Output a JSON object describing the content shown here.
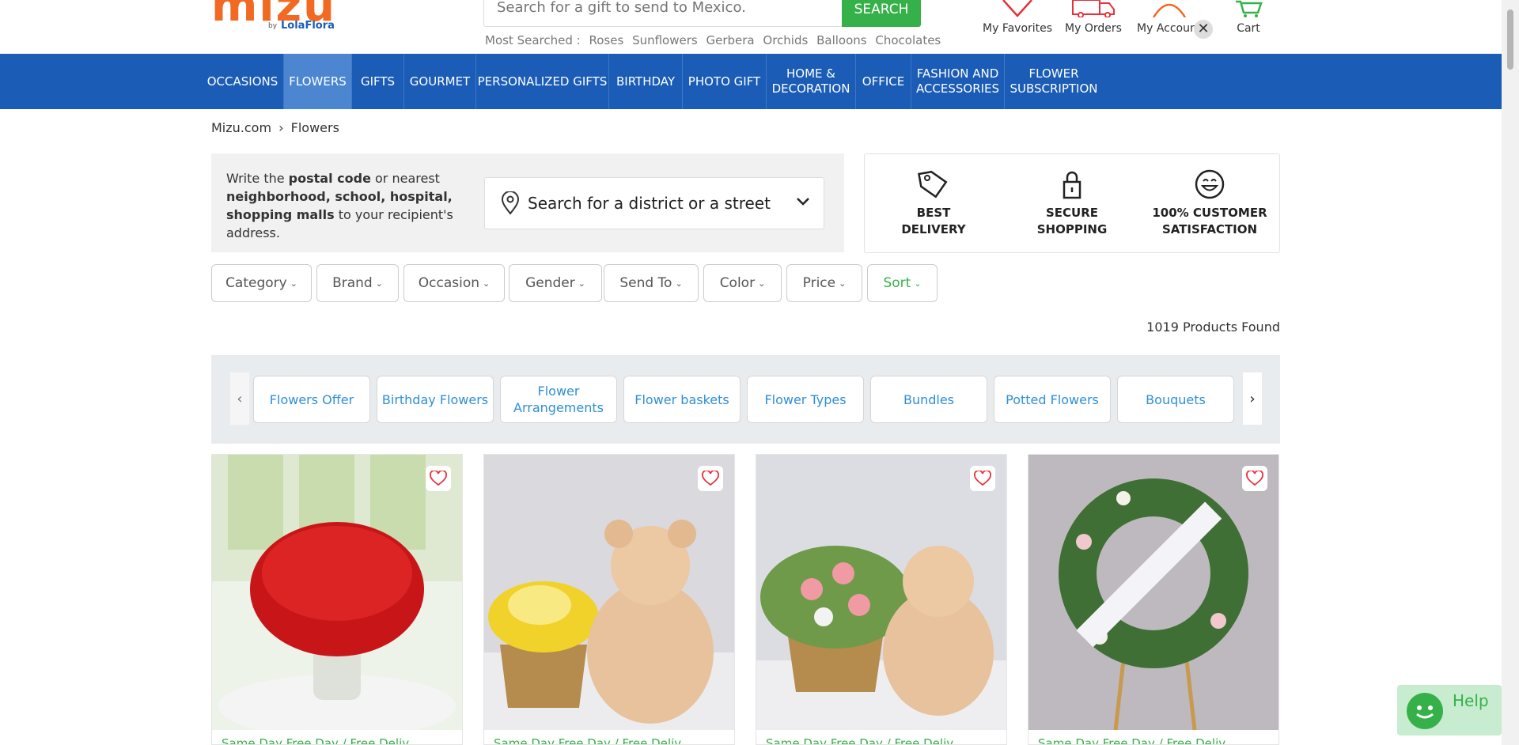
{
  "header": {
    "logo_text": "mizu",
    "logo_by": "by",
    "logo_brand": "LolaFlora",
    "search_placeholder": "Search for a gift to send to Mexico.",
    "search_button": "SEARCH",
    "most_searched_label": "Most Searched :",
    "most_searched": [
      "Roses",
      "Sunflowers",
      "Gerbera",
      "Orchids",
      "Balloons",
      "Chocolates"
    ],
    "favorites": "My Favorites",
    "orders": "My Orders",
    "account": "My Account",
    "cart": "Cart",
    "close": "✕"
  },
  "nav": {
    "items": [
      "OCCASIONS",
      "FLOWERS",
      "GIFTS",
      "GOURMET",
      "PERSONALIZED GIFTS",
      "BIRTHDAY",
      "PHOTO GIFT",
      "HOME &\nDECORATION",
      "OFFICE",
      "FASHION AND\nACCESSORIES",
      "FLOWER\nSUBSCRIPTION"
    ],
    "active": "FLOWERS"
  },
  "breadcrumb": {
    "home": "Mizu.com",
    "separator": "›",
    "current": "Flowers"
  },
  "address": {
    "t1": "Write the ",
    "b1": "postal code",
    "t2": " or nearest ",
    "b2": "neighborhood, school, hospital, shopping malls",
    "t3": " to your recipient's address.",
    "district_placeholder": "Search for a district or a street"
  },
  "features": [
    {
      "icon": "tag-icon",
      "label": "BEST\nDELIVERY"
    },
    {
      "icon": "lock-icon",
      "label": "SECURE\nSHOPPING"
    },
    {
      "icon": "smile-icon",
      "label": "100% CUSTOMER\nSATISFACTION"
    }
  ],
  "filters": [
    "Category",
    "Brand",
    "Occasion",
    "Gender",
    "Send To",
    "Color",
    "Price",
    "Sort"
  ],
  "products_found": "1019 Products Found",
  "subcategories": [
    "Flowers Offer",
    "Birthday Flowers",
    "Flower Arrangements",
    "Flower baskets",
    "Flower Types",
    "Bundles",
    "Potted Flowers",
    "Bouquets"
  ],
  "product_caption": "Same Day Free Day / Free Deliv...",
  "help": "Help",
  "colors": {
    "brand_orange": "#f26a21",
    "nav_blue": "#1b5cb6",
    "accent_green": "#36b14a",
    "link_blue": "#2e8fd6"
  }
}
